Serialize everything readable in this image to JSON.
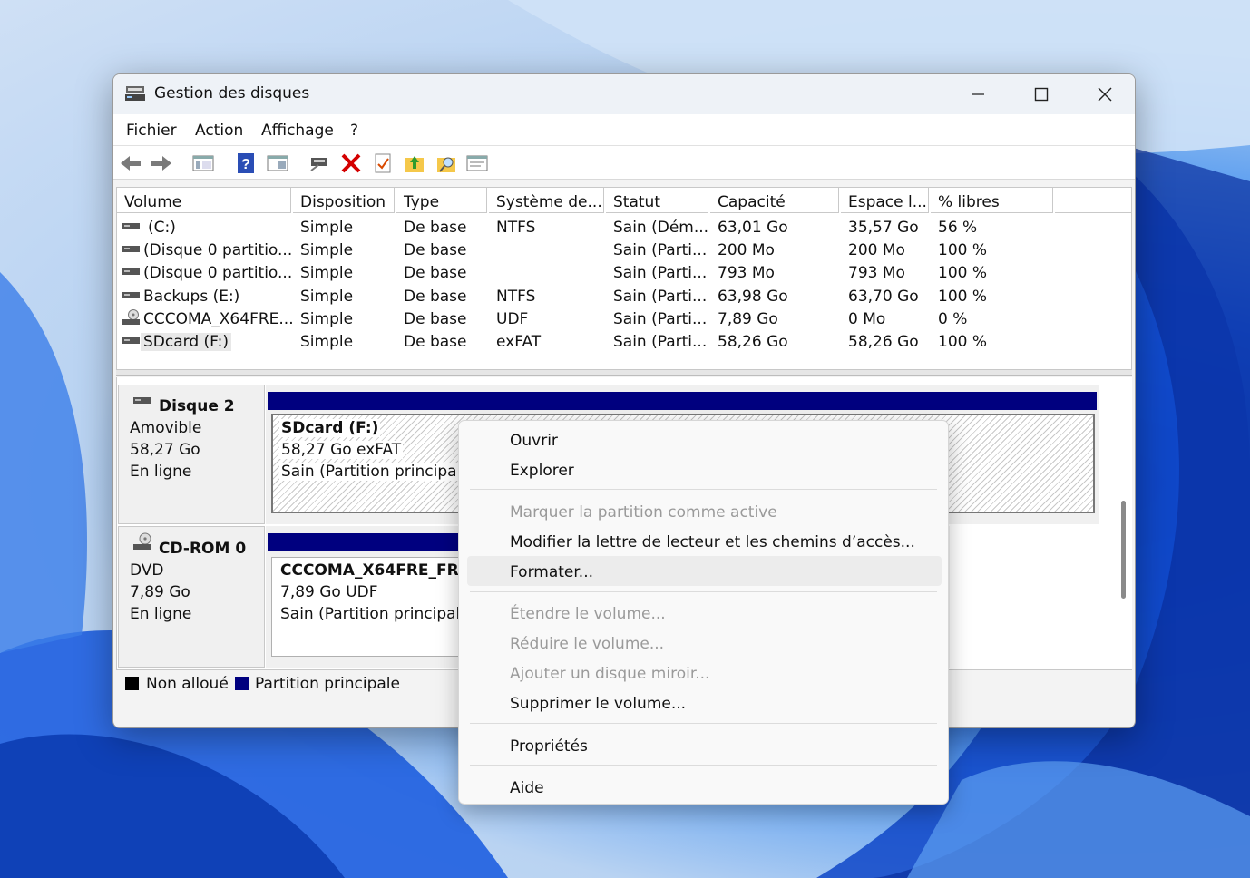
{
  "window": {
    "title": "Gestion des disques"
  },
  "menu": [
    "Fichier",
    "Action",
    "Affichage",
    "?"
  ],
  "toolbar": [
    "back-icon",
    "forward-icon",
    "console-tree-icon",
    "help-icon",
    "show-pane-icon",
    "connect-icon",
    "delete-icon",
    "check-icon",
    "up-folder-icon",
    "search-folder-icon",
    "properties-icon"
  ],
  "table": {
    "headers": [
      "Volume",
      "Disposition",
      "Type",
      "Système de...",
      "Statut",
      "Capacité",
      "Espace l...",
      "% libres"
    ],
    "rows": [
      {
        "volume": "(C:)",
        "disposition": "Simple",
        "type": "De base",
        "fs": "NTFS",
        "status": "Sain (Dém...",
        "capacity": "63,01 Go",
        "free": "35,57 Go",
        "pct": "56 %",
        "icon": "drive-icon"
      },
      {
        "volume": "(Disque 0 partitio...",
        "disposition": "Simple",
        "type": "De base",
        "fs": "",
        "status": "Sain (Parti...",
        "capacity": "200 Mo",
        "free": "200 Mo",
        "pct": "100 %",
        "icon": "drive-icon"
      },
      {
        "volume": "(Disque 0 partitio...",
        "disposition": "Simple",
        "type": "De base",
        "fs": "",
        "status": "Sain (Parti...",
        "capacity": "793 Mo",
        "free": "793 Mo",
        "pct": "100 %",
        "icon": "drive-icon"
      },
      {
        "volume": "Backups (E:)",
        "disposition": "Simple",
        "type": "De base",
        "fs": "NTFS",
        "status": "Sain (Parti...",
        "capacity": "63,98 Go",
        "free": "63,70 Go",
        "pct": "100 %",
        "icon": "drive-icon"
      },
      {
        "volume": "CCCOMA_X64FRE...",
        "disposition": "Simple",
        "type": "De base",
        "fs": "UDF",
        "status": "Sain (Parti...",
        "capacity": "7,89 Go",
        "free": "0 Mo",
        "pct": "0 %",
        "icon": "cd-icon"
      },
      {
        "volume": "SDcard (F:)",
        "disposition": "Simple",
        "type": "De base",
        "fs": "exFAT",
        "status": "Sain (Parti...",
        "capacity": "58,26 Go",
        "free": "58,26 Go",
        "pct": "100 %",
        "icon": "drive-icon"
      }
    ]
  },
  "disks": [
    {
      "name": "Disque 2",
      "lines": [
        "Amovible",
        "58,27 Go",
        "En ligne"
      ],
      "vol_name": "SDcard  (F:)",
      "vol_size": "58,27 Go exFAT",
      "vol_status": "Sain (Partition principale)"
    },
    {
      "name": "CD-ROM 0",
      "lines": [
        "DVD",
        "7,89 Go",
        "En ligne"
      ],
      "vol_name": "CCCOMA_X64FRE_FR-FR",
      "vol_size": "7,89 Go UDF",
      "vol_status": "Sain (Partition principale)"
    }
  ],
  "legend": {
    "unallocated": "Non alloué",
    "primary": "Partition principale"
  },
  "context_menu": {
    "open": "Ouvrir",
    "explore": "Explorer",
    "mark_active": "Marquer la partition comme active",
    "change_letter": "Modifier la lettre de lecteur et les chemins d’accès...",
    "format": "Formater...",
    "extend": "Étendre le volume...",
    "shrink": "Réduire le volume...",
    "mirror": "Ajouter un disque miroir...",
    "delete": "Supprimer le volume...",
    "properties": "Propriétés",
    "help": "Aide"
  },
  "colors": {
    "primary_partition": "#00007f",
    "unallocated": "#000000"
  }
}
